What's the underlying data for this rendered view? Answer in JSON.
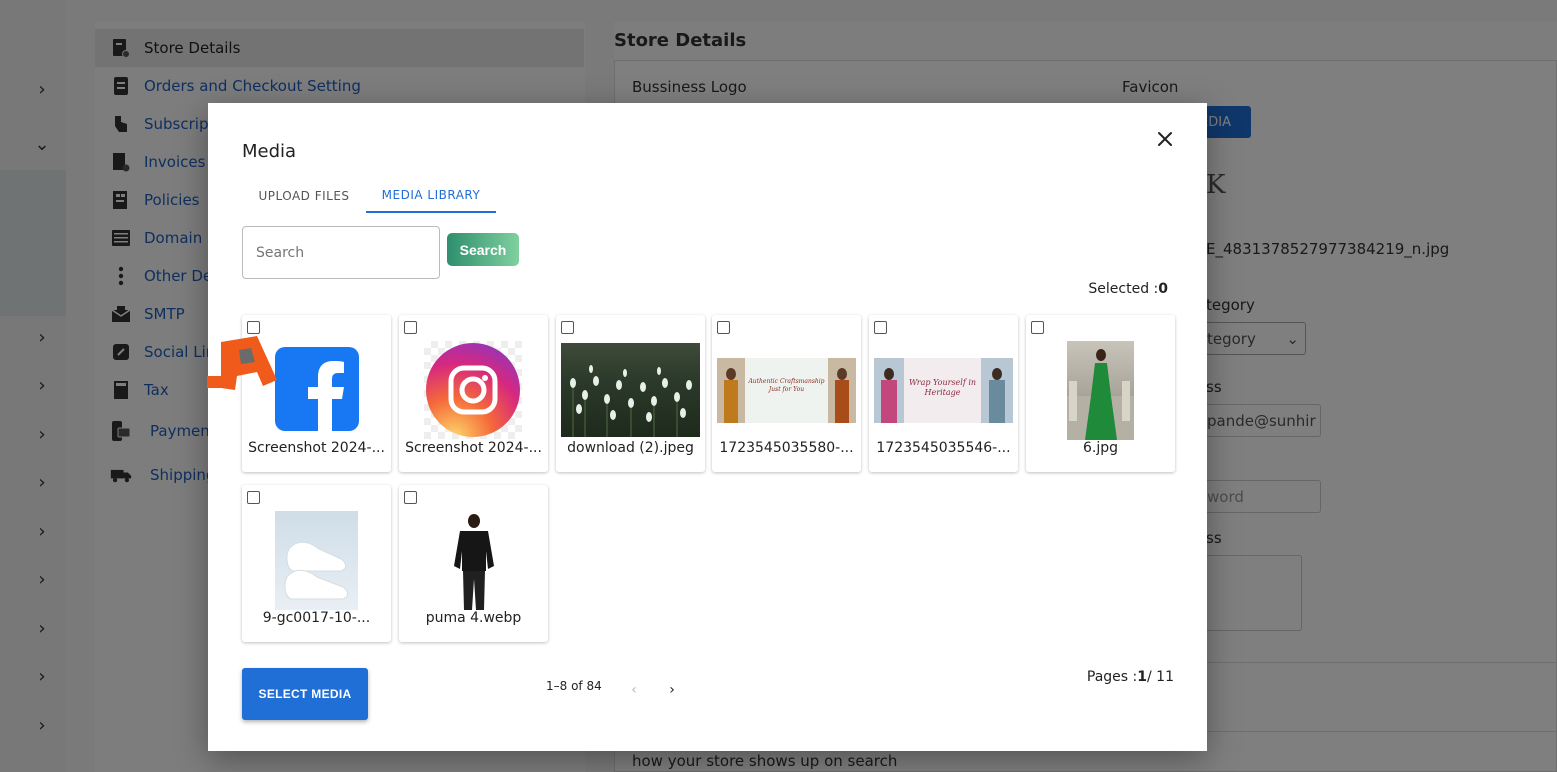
{
  "settings_nav": {
    "items": [
      {
        "label": "Store Details",
        "icon": "store-details-icon"
      },
      {
        "label": "Orders and Checkout Setting",
        "icon": "orders-icon"
      },
      {
        "label": "Subscript",
        "icon": "subscription-icon"
      },
      {
        "label": "Invoices",
        "icon": "invoice-icon"
      },
      {
        "label": "Policies",
        "icon": "policies-icon"
      },
      {
        "label": "Domain",
        "icon": "domain-icon"
      },
      {
        "label": "Other Det",
        "icon": "more-vertical-icon"
      },
      {
        "label": "SMTP",
        "icon": "mail-icon"
      },
      {
        "label": "Social Lin",
        "icon": "link-icon"
      },
      {
        "label": "Tax",
        "icon": "tax-icon"
      },
      {
        "label": "Paymen",
        "icon": "payment-icon"
      },
      {
        "label": "Shipping",
        "icon": "truck-icon"
      }
    ]
  },
  "content": {
    "title": "Store Details",
    "business_logo_label": "Bussiness Logo",
    "favicon_label": "Favicon",
    "upload_btn_fragment": "EDIA",
    "file_name_fragment": "E_4831378527977384219_n.jpg",
    "category_label_fragment": "tegory",
    "category_select_fragment": "tegory",
    "email_label_fragment": "ss",
    "email_value_fragment": "pande@sunhir",
    "password_placeholder_fragment": "word",
    "address_label_fragment": "ss",
    "seo_text": "how your store shows up on search"
  },
  "modal": {
    "title": "Media",
    "tabs": [
      {
        "label": "UPLOAD FILES"
      },
      {
        "label": "MEDIA LIBRARY"
      }
    ],
    "search": {
      "placeholder": "Search",
      "button_label": "Search"
    },
    "selected_label": "Selected :",
    "selected_count": "0",
    "items": [
      {
        "name": "Screenshot 2024-...",
        "thumb": "facebook-logo"
      },
      {
        "name": "Screenshot 2024-...",
        "thumb": "instagram-logo"
      },
      {
        "name": "download (2).jpeg",
        "thumb": "snowdrop-flowers"
      },
      {
        "name": "1723545035580-...",
        "thumb": "authentic-craftsmanship-banner"
      },
      {
        "name": "1723545035546-...",
        "thumb": "wrap-yourself-heritage-banner"
      },
      {
        "name": "6.jpg",
        "thumb": "green-dress-model"
      },
      {
        "name": "9-gc0017-10-...",
        "thumb": "white-sneakers"
      },
      {
        "name": "puma 4.webp",
        "thumb": "black-tracksuit-model"
      }
    ],
    "banner_texts": {
      "authentic": "Authentic Craftsmanship Just for You",
      "wrap": "Wrap Yourself in Heritage"
    },
    "select_media_label": "SELECT MEDIA",
    "page_range": "1–8 of 84",
    "pages_label": "Pages :",
    "current_page": "1",
    "total_pages": "/ 11"
  },
  "colors": {
    "accent": "#1f6fd6",
    "search_gradient_start": "#2e8f6e",
    "search_gradient_end": "#7fd09e",
    "nav_link": "#1f5fbf"
  }
}
